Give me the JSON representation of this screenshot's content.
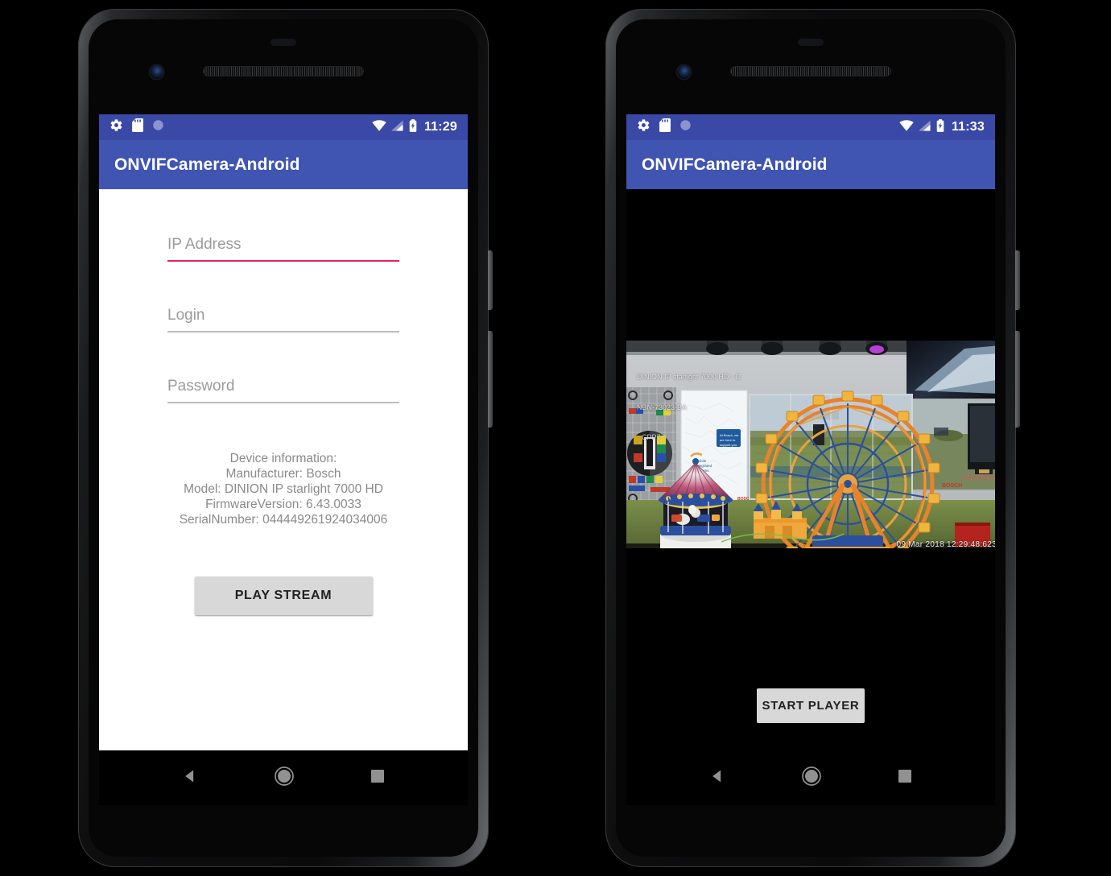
{
  "app": {
    "title": "ONVIFCamera-Android",
    "appbar_color": "#4054b2",
    "statusbar_color": "#3a48a6",
    "accent_color": "#e91e63"
  },
  "phones": [
    {
      "id": "phone-left",
      "status_bar": {
        "time": "11:29",
        "icons_left": [
          "settings-gear-icon",
          "sd-card-icon",
          "do-not-disturb-icon"
        ],
        "icons_right": [
          "wifi-icon",
          "cell-signal-icon",
          "battery-charging-icon"
        ]
      },
      "screen": "setup",
      "fields": [
        {
          "name": "ip-address",
          "placeholder": "IP Address",
          "value": "",
          "focused": true
        },
        {
          "name": "login",
          "placeholder": "Login",
          "value": "",
          "focused": false
        },
        {
          "name": "password",
          "placeholder": "Password",
          "value": "",
          "focused": false
        }
      ],
      "device_information": {
        "heading": "Device information:",
        "manufacturer": "Manufacturer: Bosch",
        "model": "Model: DINION IP starlight 7000 HD",
        "firmware": "FirmwareVersion: 6.43.0033",
        "serial": "SerialNumber: 044449261924034006"
      },
      "primary_button": "PLAY STREAM"
    },
    {
      "id": "phone-right",
      "status_bar": {
        "time": "11:33",
        "icons_left": [
          "settings-gear-icon",
          "sd-card-icon",
          "do-not-disturb-icon"
        ],
        "icons_right": [
          "wifi-icon",
          "cell-signal-icon",
          "battery-charging-icon"
        ]
      },
      "screen": "player",
      "video_overlay": {
        "line1": "DINION IP starlight 7000 HD - C",
        "line2": "NBN-73023-BA",
        "line3": "CPP7",
        "timestamp": "09.Mar 2018   12:29:48:623"
      },
      "video_scene": "ferris-wheel-and-carousel-camera-test-scene",
      "primary_button": "START PLAYER"
    }
  ],
  "nav_bar": {
    "back": "back-button",
    "home": "home-button",
    "recents": "recents-button"
  }
}
